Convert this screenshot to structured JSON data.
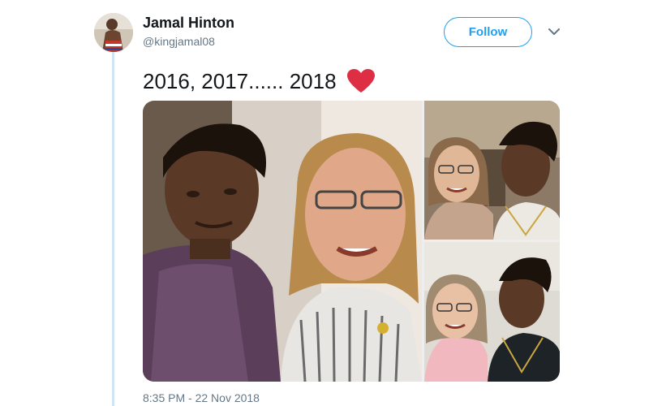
{
  "user": {
    "display_name": "Jamal Hinton",
    "handle": "@kingjamal08"
  },
  "follow_button": {
    "label": "Follow"
  },
  "more_menu": {
    "icon": "chevron-down-icon"
  },
  "tweet": {
    "text": "2016, 2017...... 2018",
    "emoji": "red-heart-icon",
    "timestamp": "8:35 PM - 22 Nov 2018"
  },
  "media": {
    "photos": [
      "photo-1",
      "photo-2",
      "photo-3"
    ]
  },
  "colors": {
    "accent": "#1da1f2",
    "text_primary": "#14171a",
    "text_secondary": "#657786",
    "thread_line": "#cfe6f5",
    "heart": "#dd2e44"
  }
}
